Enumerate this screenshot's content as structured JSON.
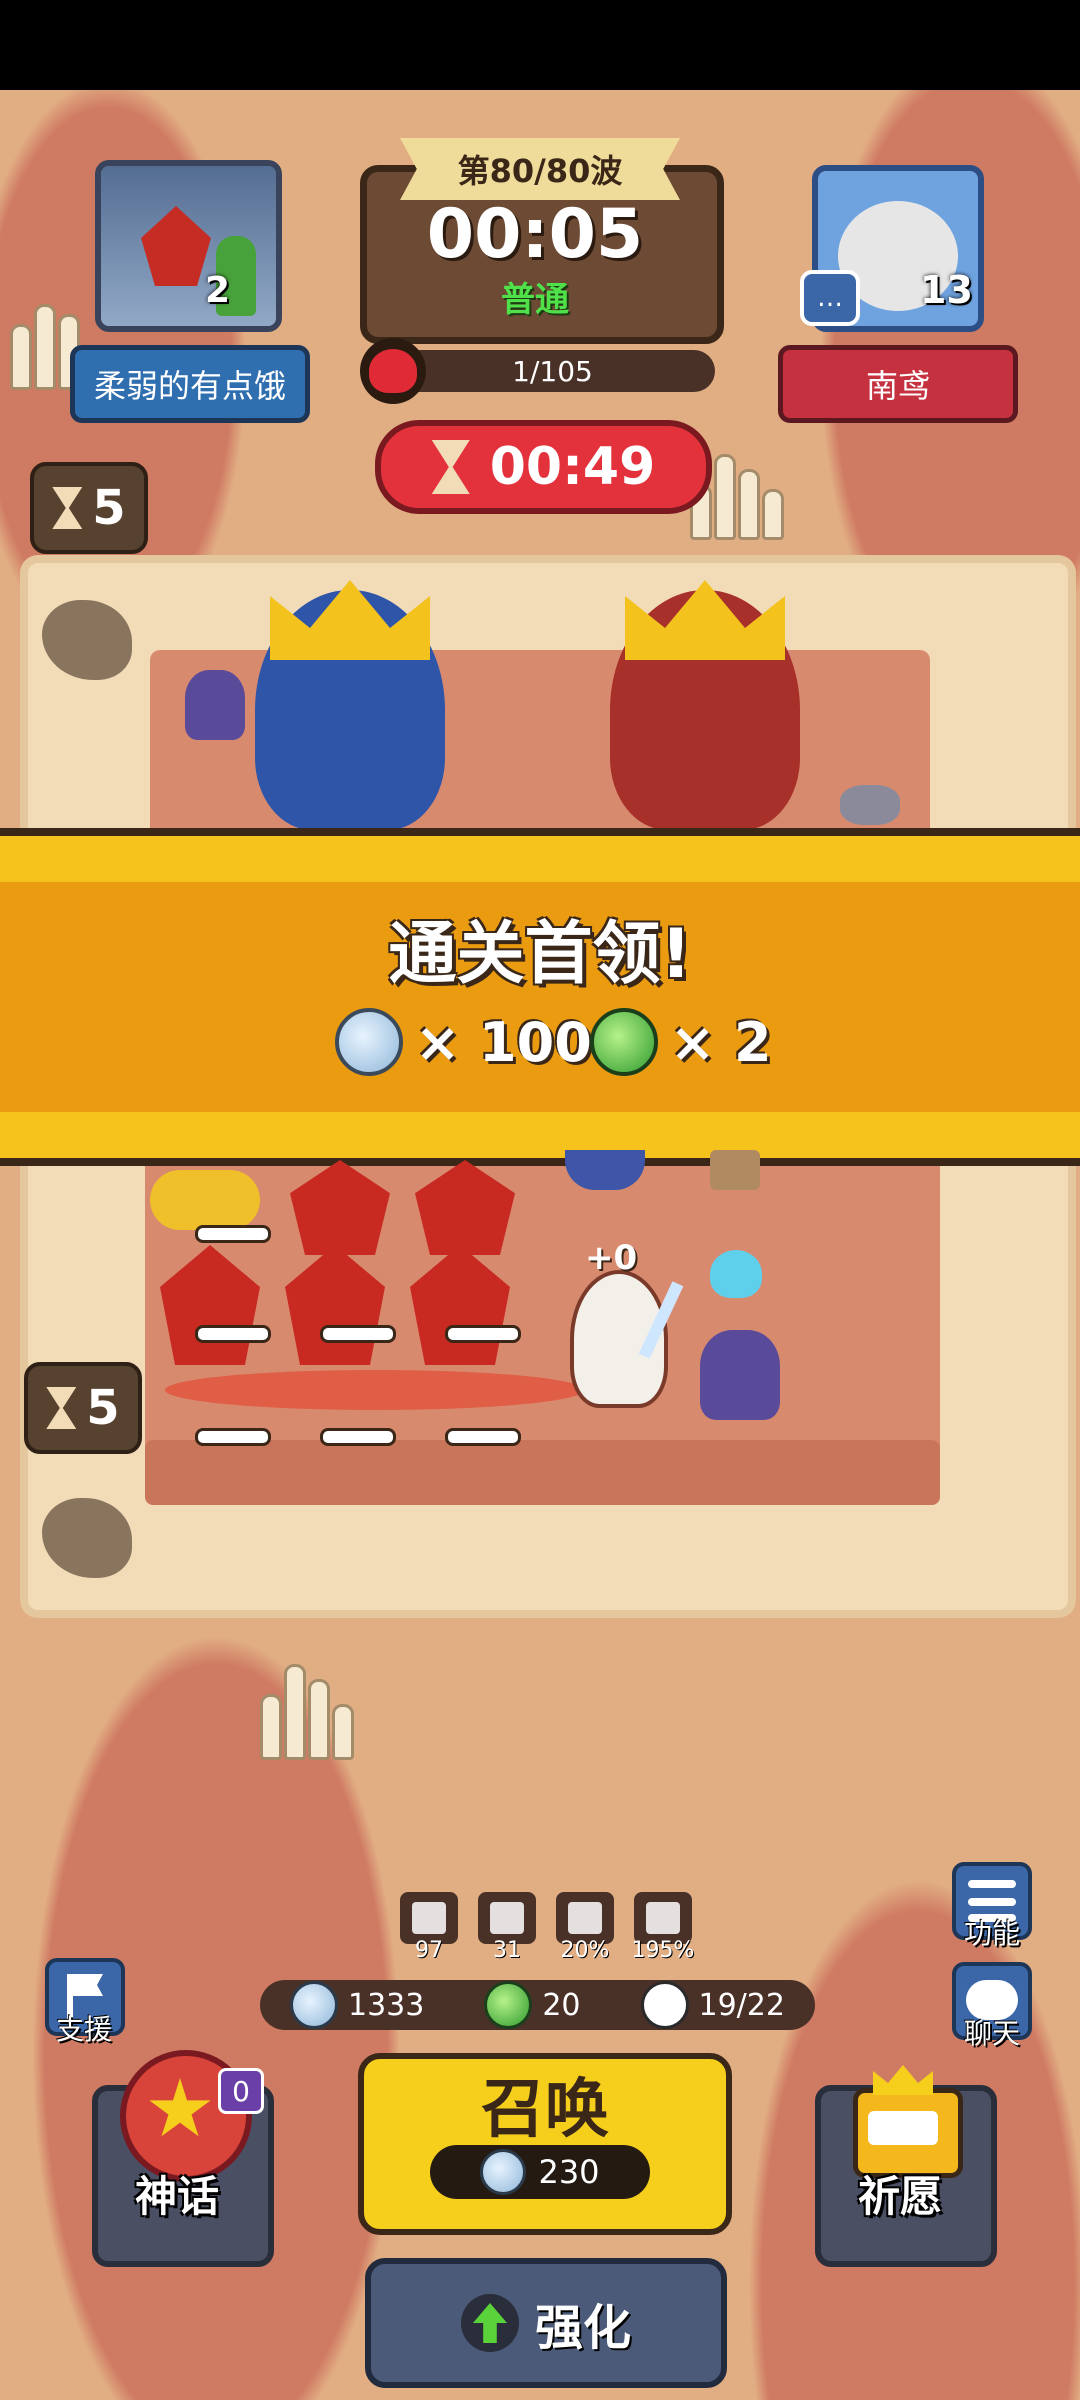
{
  "header": {
    "wave_label": "第80/80波",
    "timer": "00:05",
    "difficulty": "普通",
    "enemy_count": "1/105",
    "countdown": "00:49"
  },
  "player": {
    "name": "柔弱的有点饿",
    "boss_level": "2"
  },
  "opponent": {
    "name": "南鸢",
    "level": "13"
  },
  "board": {
    "top_timer": "5",
    "bottom_timer": "5",
    "float_text": "+0"
  },
  "banner": {
    "title": "通关首领!",
    "reward_silver": "× 100",
    "reward_green": "× 2"
  },
  "stats": {
    "values": [
      "97",
      "31",
      "20%",
      "195%"
    ]
  },
  "resources": {
    "silver": "1333",
    "green": "20",
    "units": "19/22"
  },
  "buttons": {
    "support": "支援",
    "function": "功能",
    "chat": "聊天",
    "myth": "神话",
    "myth_badge": "0",
    "summon": "召唤",
    "summon_cost": "230",
    "wish": "祈愿",
    "enhance": "强化"
  },
  "colors": {
    "banner": "#eb9b10",
    "player_name_bg": "#2f6fb0",
    "opponent_name_bg": "#c5313e",
    "summon": "#f5cf1c"
  }
}
